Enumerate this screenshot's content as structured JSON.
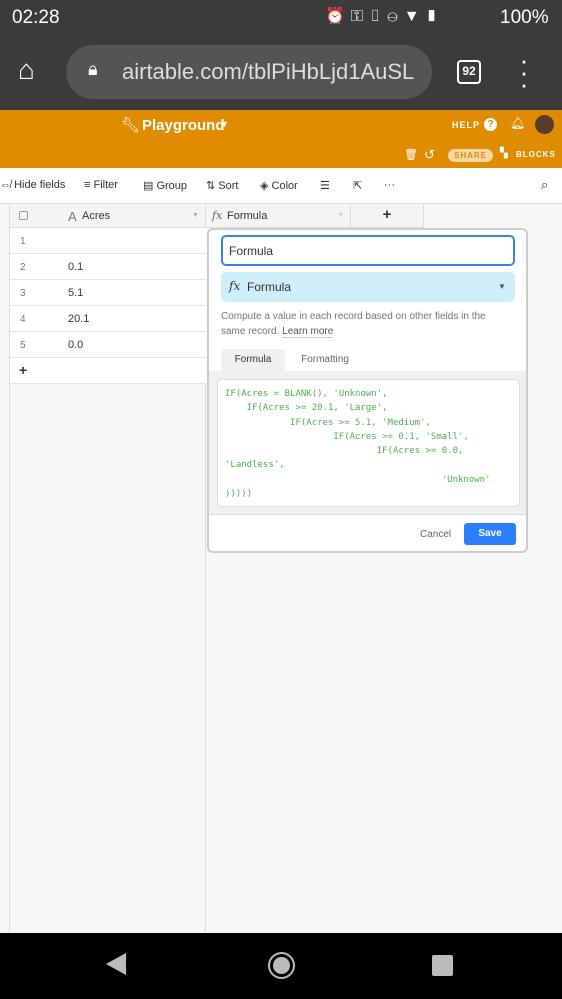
{
  "status_bar": {
    "time": "02:28",
    "battery": "100%"
  },
  "browser": {
    "url": "airtable.com/tblPiHbLjd1AuSL",
    "tab_count": "92"
  },
  "app_header": {
    "base_name": "Playground",
    "help": "HELP",
    "share": "SHARE",
    "blocks": "BLOCKS",
    "accent": "#e08c00"
  },
  "toolbar": {
    "hide_fields": "Hide fields",
    "filter": "Filter",
    "group": "Group",
    "sort": "Sort",
    "color": "Color"
  },
  "grid": {
    "columns": [
      {
        "name": "Acres",
        "type": "text"
      },
      {
        "name": "Formula",
        "type": "formula"
      }
    ],
    "add_column": "+",
    "add_row": "+",
    "rows": [
      {
        "num": "1",
        "acres": ""
      },
      {
        "num": "2",
        "acres": "0.1"
      },
      {
        "num": "3",
        "acres": "5.1"
      },
      {
        "num": "4",
        "acres": "20.1"
      },
      {
        "num": "5",
        "acres": "0.0"
      }
    ]
  },
  "popup": {
    "field_name": "Formula",
    "field_type": "Formula",
    "description": "Compute a value in each record based on other fields in the same record.",
    "learn_more": "Learn more",
    "tabs": [
      "Formula",
      "Formatting"
    ],
    "formula": "IF(Acres = BLANK(), 'Unknown',\n    IF(Acres >= 20.1, 'Large',\n            IF(Acres >= 5.1, 'Medium',\n                    IF(Acres >= 0.1, 'Small',\n                            IF(Acres >= 0.0,\n'Landless',\n                                        'Unknown'\n)))))",
    "cancel": "Cancel",
    "save": "Save"
  }
}
